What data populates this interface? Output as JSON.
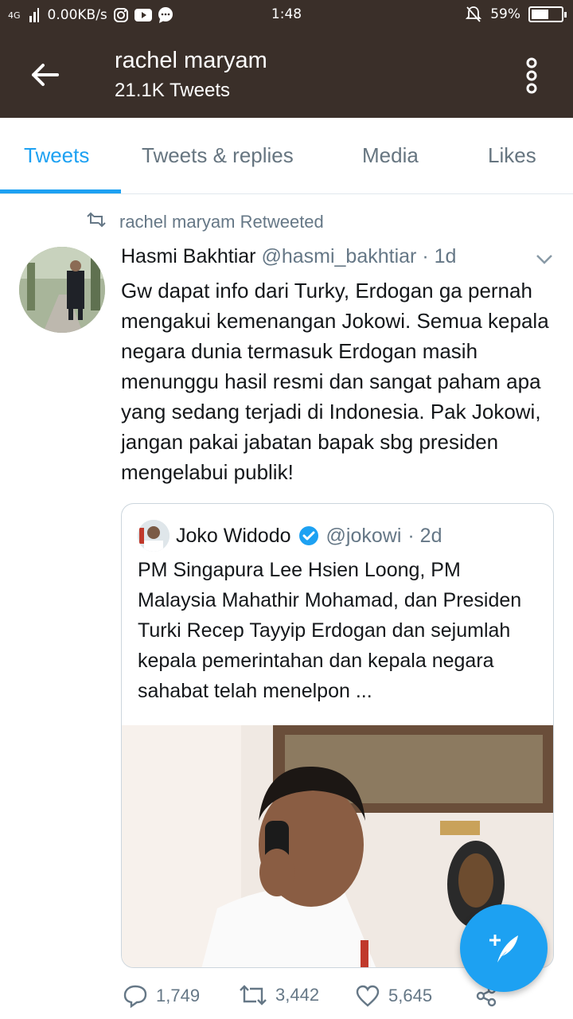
{
  "status_bar": {
    "network_type": "4G",
    "data_speed": "0.00KB/s",
    "time": "1:48",
    "battery_percent": "59%",
    "battery_level": 0.59
  },
  "app_bar": {
    "title": "rachel maryam",
    "subtitle": "21.1K Tweets",
    "background": "#3a2f29"
  },
  "tabs": [
    {
      "label": "Tweets",
      "active": true
    },
    {
      "label": "Tweets & replies",
      "active": false
    },
    {
      "label": "Media",
      "active": false
    },
    {
      "label": "Likes",
      "active": false
    }
  ],
  "tweet": {
    "retweet_label": "rachel maryam Retweeted",
    "author_name": "Hasmi Bakhtiar",
    "author_handle": "@hasmi_bakhtiar",
    "time": "· 1d",
    "text": "Gw dapat info dari Turky, Erdogan ga pernah mengakui kemenangan Jokowi. Semua kepala negara dunia termasuk Erdogan masih menunggu hasil resmi dan sangat paham apa yang sedang terjadi di Indonesia. Pak Jokowi, jangan pakai jabatan bapak sbg presiden mengelabui publik!",
    "quoted": {
      "name": "Joko Widodo",
      "handle": "@jokowi",
      "time": "· 2d",
      "text": "PM Singapura Lee Hsien Loong, PM Malaysia Mahathir Mohamad, dan Presiden Turki Recep Tayyip Erdogan dan sejumlah kepala pemerintahan dan kepala negara sahabat telah menelpon ..."
    },
    "actions": {
      "replies": "1,749",
      "retweets": "3,442",
      "likes": "5,645"
    }
  },
  "colors": {
    "accent": "#1da1f2",
    "text_secondary": "#657786"
  }
}
